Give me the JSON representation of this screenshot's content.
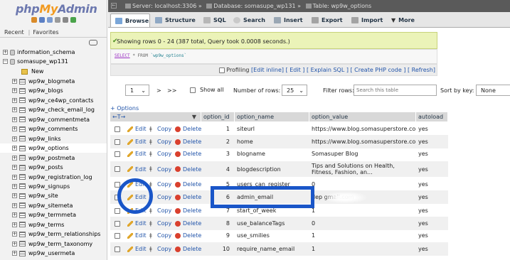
{
  "app": {
    "logo_php": "php",
    "logo_my": "My",
    "logo_admin": "Admin"
  },
  "sidebar": {
    "tabs": [
      "Recent",
      "Favorites"
    ],
    "databases": [
      {
        "name": "information_schema",
        "expanded": false
      },
      {
        "name": "somasupe_wp131",
        "expanded": true
      }
    ],
    "new_label": "New",
    "tables": [
      "wp9w_blogmeta",
      "wp9w_blogs",
      "wp9w_ce4wp_contacts",
      "wp9w_check_email_log",
      "wp9w_commentmeta",
      "wp9w_comments",
      "wp9w_links",
      "wp9w_options",
      "wp9w_postmeta",
      "wp9w_posts",
      "wp9w_registration_log",
      "wp9w_signups",
      "wp9w_site",
      "wp9w_sitemeta",
      "wp9w_termmeta",
      "wp9w_terms",
      "wp9w_term_relationships",
      "wp9w_term_taxonomy",
      "wp9w_usermeta"
    ],
    "active_table": "wp9w_options"
  },
  "breadcrumb": {
    "server": "Server: localhost:3306",
    "database": "Database: somasupe_wp131",
    "table": "Table: wp9w_options"
  },
  "tabs": [
    {
      "label": "Browse",
      "icon": "browse-icon"
    },
    {
      "label": "Structure",
      "icon": "structure-icon"
    },
    {
      "label": "SQL",
      "icon": "sql-icon"
    },
    {
      "label": "Search",
      "icon": "search-icon"
    },
    {
      "label": "Insert",
      "icon": "insert-icon"
    },
    {
      "label": "Export",
      "icon": "export-icon"
    },
    {
      "label": "Import",
      "icon": "import-icon"
    },
    {
      "label": "More",
      "icon": "chevron-down-icon"
    }
  ],
  "query": {
    "success": "Showing rows 0 - 24 (387 total, Query took 0.0008 seconds.)",
    "sql_select": "SELECT",
    "sql_rest": "* FROM",
    "sql_table": "`wp9w_options`",
    "profiling": "Profiling",
    "links": [
      "[Edit inline]",
      "[ Edit ]",
      "[ Explain SQL ]",
      "[ Create PHP code ]",
      "[ Refresh]"
    ]
  },
  "nav": {
    "page": "1",
    "next": ">",
    "last": ">>",
    "show_all": "Show all",
    "rows_label": "Number of rows:",
    "rows_value": "25",
    "filter_label": "Filter rows:",
    "filter_placeholder": "Search this table",
    "sort_label": "Sort by key:",
    "sort_value": "None"
  },
  "options_link": "+ Options",
  "table": {
    "columns": [
      "option_id",
      "option_name",
      "option_value",
      "autoload"
    ],
    "actions": {
      "edit": "Edit",
      "copy": "Copy",
      "delete": "Delete"
    },
    "rows": [
      {
        "id": "1",
        "name": "siteurl",
        "value": "https://www.blog.somasuperstore.com",
        "autoload": "yes"
      },
      {
        "id": "2",
        "name": "home",
        "value": "https://www.blog.somasuperstore.com",
        "autoload": "yes"
      },
      {
        "id": "3",
        "name": "blogname",
        "value": "Somasuper Blog",
        "autoload": "yes"
      },
      {
        "id": "4",
        "name": "blogdescription",
        "value": "Tips and Solutions on Health, Fitness, Fashion, an...",
        "autoload": "yes"
      },
      {
        "id": "5",
        "name": "users_can_register",
        "value": "0",
        "autoload": "yes"
      },
      {
        "id": "6",
        "name": "admin_email",
        "value": "dep gmail.com",
        "autoload": "yes"
      },
      {
        "id": "7",
        "name": "start_of_week",
        "value": "1",
        "autoload": "yes"
      },
      {
        "id": "8",
        "name": "use_balanceTags",
        "value": "0",
        "autoload": "yes"
      },
      {
        "id": "9",
        "name": "use_smilies",
        "value": "1",
        "autoload": "yes"
      },
      {
        "id": "10",
        "name": "require_name_email",
        "value": "1",
        "autoload": "yes"
      }
    ]
  },
  "colors": {
    "annotation": "#1a56c8",
    "success_bg": "#ebf3b8",
    "link": "#2255aa"
  }
}
